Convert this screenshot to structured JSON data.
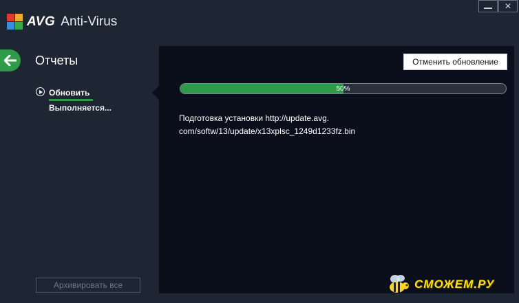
{
  "app": {
    "brand": "AVG",
    "product": "Anti-Virus",
    "logo_colors": [
      "#e23a2e",
      "#f0a92c",
      "#3a8fd8",
      "#3aaa49"
    ]
  },
  "window_controls": {
    "minimize_icon": "minimize-icon",
    "close_icon": "close-icon",
    "close_glyph": "✕"
  },
  "header": {
    "back_icon": "arrow-left-icon",
    "title": "Отчеты"
  },
  "sidebar": {
    "items": [
      {
        "icon": "play-circle-icon",
        "label": "Обновить",
        "status": "Выполняется..."
      }
    ],
    "archive_button": "Архивировать все"
  },
  "main": {
    "cancel_button": "Отменить обновление",
    "progress": {
      "value": 0.5,
      "label": "50%"
    },
    "status_lines": [
      "Подготовка установки http://update.avg.",
      "com/softw/13/update/x13xplsc_1249d1233fz.bin"
    ]
  },
  "watermark": {
    "text": "СМОЖЕМ.РУ",
    "icon": "bee-icon"
  },
  "colors": {
    "accent": "#2f9a47",
    "background": "#1f2633",
    "panel": "#0b0f1c"
  }
}
